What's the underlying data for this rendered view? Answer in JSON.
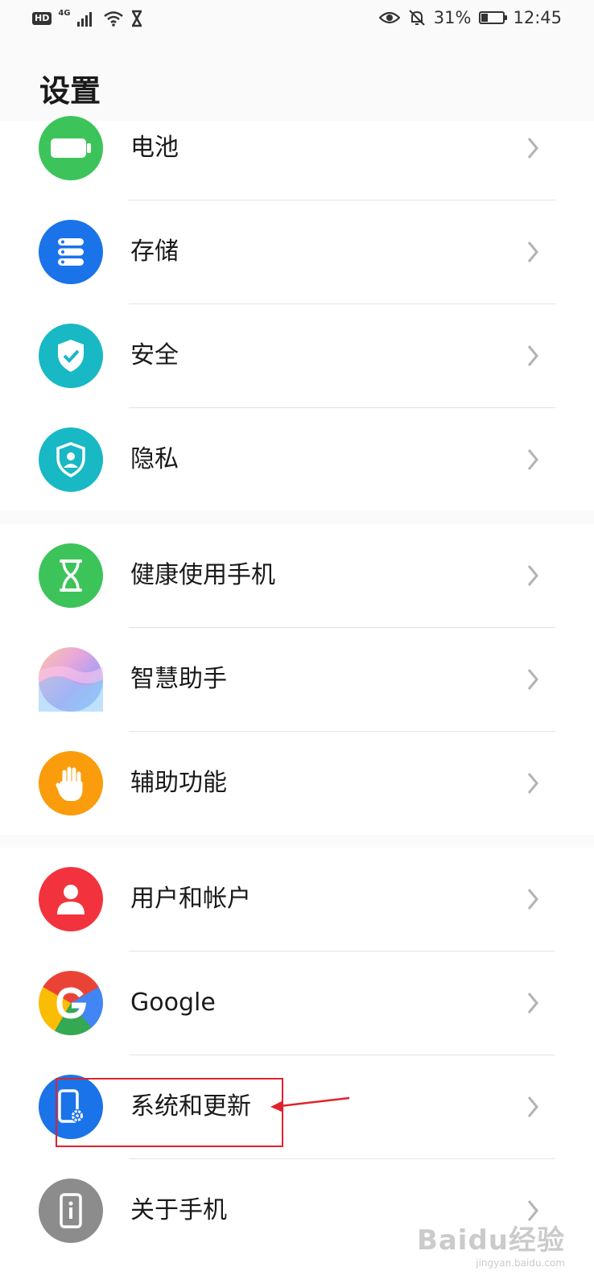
{
  "status_bar": {
    "hd": "HD",
    "network": "4G",
    "battery_percent": "31%",
    "battery_level": 0.31,
    "time": "12:45"
  },
  "page": {
    "title": "设置"
  },
  "items": [
    {
      "label": "电池",
      "icon": "battery-icon",
      "color": "#3cc45a"
    },
    {
      "label": "存储",
      "icon": "storage-icon",
      "color": "#1a73e8"
    },
    {
      "label": "安全",
      "icon": "shield-check-icon",
      "color": "#18b8c5"
    },
    {
      "label": "隐私",
      "icon": "privacy-icon",
      "color": "#18b8c5"
    },
    {
      "label": "健康使用手机",
      "icon": "hourglass-icon",
      "color": "#3cc45a"
    },
    {
      "label": "智慧助手",
      "icon": "assistant-icon",
      "color": "#c8a8e8"
    },
    {
      "label": "辅助功能",
      "icon": "hand-icon",
      "color": "#fa9c0c"
    },
    {
      "label": "用户和帐户",
      "icon": "user-icon",
      "color": "#f2333d"
    },
    {
      "label": "Google",
      "icon": "google-icon",
      "color": "#4285f4"
    },
    {
      "label": "系统和更新",
      "icon": "phone-gear-icon",
      "color": "#1a73e8"
    },
    {
      "label": "关于手机",
      "icon": "phone-info-icon",
      "color": "#8c8c8c"
    }
  ],
  "watermark": {
    "main": "Baidu经验",
    "sub": "jingyan.baidu.com"
  }
}
